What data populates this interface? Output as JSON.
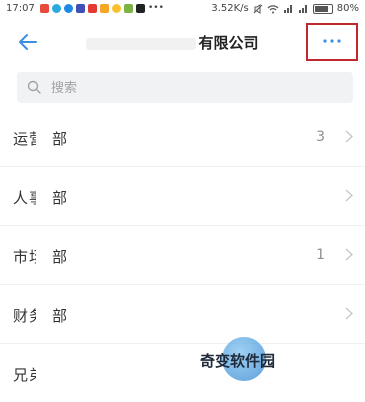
{
  "status_bar": {
    "time": "17:07",
    "network_speed": "3.52K/s",
    "battery": "80%",
    "app_icon_colors": [
      "#e64a3c",
      "#2aa8e0",
      "#1e88e5",
      "#3f51b5",
      "#e53935",
      "#f5a623",
      "#fbc02d",
      "#7cb342",
      "#222222"
    ]
  },
  "header": {
    "title": "有限公司",
    "back_icon": "arrow-left-icon",
    "more_icon": "more-horizontal-icon",
    "accent_color": "#3a8ee6",
    "highlight_color": "#c0282d"
  },
  "search": {
    "placeholder": "搜索",
    "value": ""
  },
  "departments": [
    {
      "prefix": "运营",
      "suffix": "部",
      "count": "3"
    },
    {
      "prefix": "人事",
      "suffix": "部",
      "count": ""
    },
    {
      "prefix": "市场",
      "suffix": "部",
      "count": "1"
    },
    {
      "prefix": "财务",
      "suffix": "部",
      "count": ""
    },
    {
      "prefix": "兄弟",
      "suffix": "",
      "count": ""
    }
  ],
  "watermark": {
    "text": "奇变软件园"
  }
}
